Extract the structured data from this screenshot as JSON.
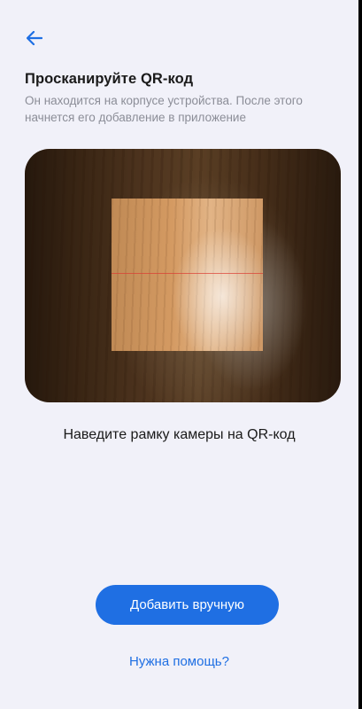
{
  "header": {
    "back_icon": "arrow-left-icon",
    "title": "Просканируйте QR-код",
    "subtitle": "Он находится на корпусе устройства. После этого начнется его добавление в приложение"
  },
  "camera": {
    "hint": "Наведите рамку камеры на QR-код"
  },
  "actions": {
    "add_manually_label": "Добавить вручную",
    "help_label": "Нужна помощь?"
  },
  "colors": {
    "accent": "#1f6fe3",
    "background": "#f1f1f9"
  }
}
